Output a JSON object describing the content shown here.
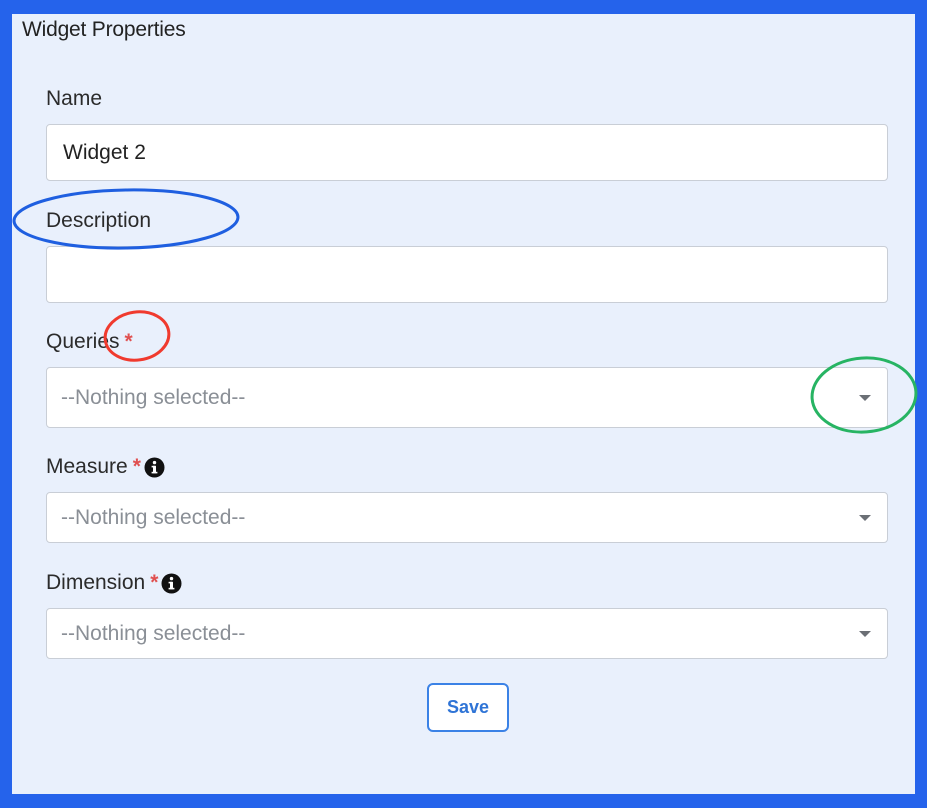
{
  "panel": {
    "title": "Widget Properties"
  },
  "fields": {
    "name": {
      "label": "Name",
      "value": "Widget 2"
    },
    "description": {
      "label": "Description",
      "value": ""
    },
    "queries": {
      "label": "Queries",
      "required_mark": "*",
      "selected": "--Nothing selected--",
      "icon": "chevron-down-icon"
    },
    "measure": {
      "label": "Measure",
      "required_mark": "*",
      "info_icon": "info-icon",
      "selected": "--Nothing selected--",
      "icon": "chevron-down-icon"
    },
    "dimension": {
      "label": "Dimension",
      "required_mark": "*",
      "info_icon": "info-icon",
      "selected": "--Nothing selected--",
      "icon": "chevron-down-icon"
    }
  },
  "actions": {
    "save_label": "Save"
  },
  "colors": {
    "frame_border": "#2563eb",
    "panel_background": "#e9f0fc",
    "required_asterisk": "#e05050",
    "save_button": "#3b82e6",
    "annotation_blue": "#1f5fe0",
    "annotation_red": "#f03a2e",
    "annotation_green": "#27b463"
  }
}
